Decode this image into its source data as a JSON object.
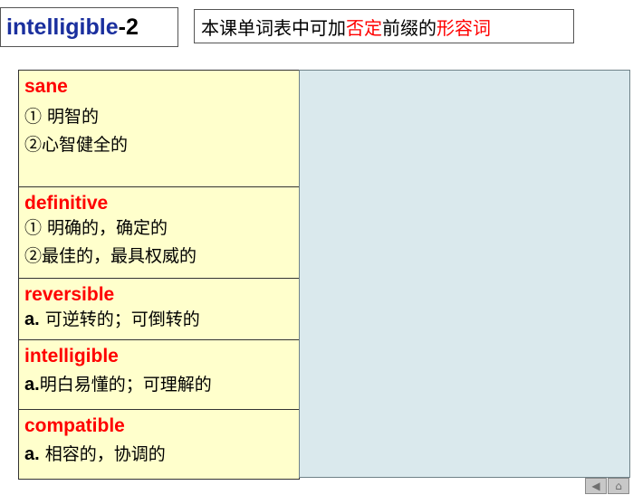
{
  "title": {
    "main": "intelligible",
    "suffix": "-2"
  },
  "subtitle": {
    "part1": "本课单词表中可加",
    "part2_red": "否定",
    "part3": "前缀的",
    "part4_red": "形容词"
  },
  "words": [
    {
      "word": "sane",
      "defs": [
        "① 明智的",
        "②心智健全的"
      ]
    },
    {
      "word": "definitive",
      "defs": [
        "① 明确的，确定的",
        "②最佳的，最具权威的"
      ]
    },
    {
      "word": "reversible",
      "prefix": "a.",
      "defs": [
        " 可逆转的；可倒转的"
      ]
    },
    {
      "word": "intelligible",
      "prefix": "a.",
      "defs": [
        "明白易懂的；可理解的"
      ]
    },
    {
      "word": "compatible",
      "prefix": "a.",
      "defs": [
        " 相容的，协调的"
      ]
    }
  ],
  "nav": {
    "prev_icon": "triangle-left-icon",
    "home_icon": "house-icon"
  },
  "colors": {
    "title_blue": "#1a2f9e",
    "accent_red": "#ff0000",
    "cell_yellow": "#ffffcc",
    "panel_blue": "#dae9ed"
  }
}
